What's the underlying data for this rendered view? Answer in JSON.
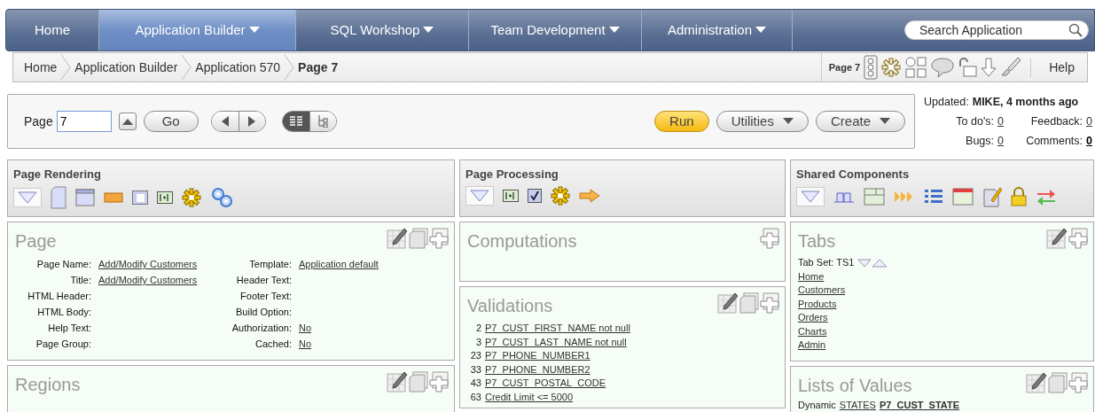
{
  "nav": {
    "tabs": [
      {
        "label": "Home",
        "selected": false,
        "menu": false
      },
      {
        "label": "Application Builder",
        "selected": true,
        "menu": true
      },
      {
        "label": "SQL Workshop",
        "selected": false,
        "menu": true
      },
      {
        "label": "Team Development",
        "selected": false,
        "menu": true
      },
      {
        "label": "Administration",
        "selected": false,
        "menu": true
      }
    ],
    "search": {
      "placeholder": "Search Application"
    }
  },
  "breadcrumb": {
    "items": [
      {
        "label": "Home",
        "current": false
      },
      {
        "label": "Application Builder",
        "current": false
      },
      {
        "label": "Application 570",
        "current": false
      },
      {
        "label": "Page 7",
        "current": true
      }
    ],
    "page_label": "Page 7",
    "help": "Help"
  },
  "toolbar": {
    "page_label": "Page",
    "page_value": "7",
    "go": "Go",
    "views": [
      {
        "kind": "list",
        "selected": true
      },
      {
        "kind": "tree",
        "selected": false
      }
    ],
    "run": "Run",
    "utilities": "Utilities",
    "create": "Create"
  },
  "info": {
    "updated_label": "Updated:",
    "updated_value": "MIKE, 4 months ago",
    "counters": [
      {
        "label": "To do's:",
        "value": "0",
        "bold": false
      },
      {
        "label": "Feedback:",
        "value": "0",
        "bold": false
      },
      {
        "label": "Bugs:",
        "value": "0",
        "bold": false
      },
      {
        "label": "Comments:",
        "value": "0",
        "bold": true
      }
    ]
  },
  "page_rendering": {
    "title": "Page Rendering"
  },
  "page_processing": {
    "title": "Page Processing"
  },
  "shared_components": {
    "title": "Shared Components"
  },
  "page": {
    "title": "Page",
    "fields": [
      {
        "label": "Page Name:",
        "value": "Add/Modify Customers"
      },
      {
        "label": "Template:",
        "value": "Application default"
      },
      {
        "label": "Title:",
        "value": "Add/Modify Customers"
      },
      {
        "label": "Header Text:"
      },
      {
        "label": "HTML Header:"
      },
      {
        "label": "Footer Text:"
      },
      {
        "label": "HTML Body:"
      },
      {
        "label": "Build Option:"
      },
      {
        "label": "Help Text:"
      },
      {
        "label": "Authorization:",
        "value": "No"
      },
      {
        "label": "Page Group:"
      },
      {
        "label": "Cached:",
        "value": "No"
      }
    ]
  },
  "regions": {
    "title": "Regions"
  },
  "computations": {
    "title": "Computations"
  },
  "validations": {
    "title": "Validations",
    "items": [
      {
        "seq": "2",
        "name": "P7_CUST_FIRST_NAME not null"
      },
      {
        "seq": "3",
        "name": "P7_CUST_LAST_NAME not null"
      },
      {
        "seq": "23",
        "name": "P7_PHONE_NUMBER1"
      },
      {
        "seq": "33",
        "name": "P7_PHONE_NUMBER2"
      },
      {
        "seq": "43",
        "name": "P7_CUST_POSTAL_CODE"
      },
      {
        "seq": "63",
        "name": "Credit Limit <= 5000"
      }
    ]
  },
  "tabs_panel": {
    "title": "Tabs",
    "tab_set": "Tab Set: TS1",
    "tabs": [
      "Home",
      "Customers",
      "Products",
      "Orders",
      "Charts",
      "Admin"
    ]
  },
  "lists_of_values": {
    "title": "Lists of Values",
    "items": [
      {
        "type": "Dynamic",
        "name": "STATES",
        "item": "P7_CUST_STATE"
      }
    ]
  }
}
